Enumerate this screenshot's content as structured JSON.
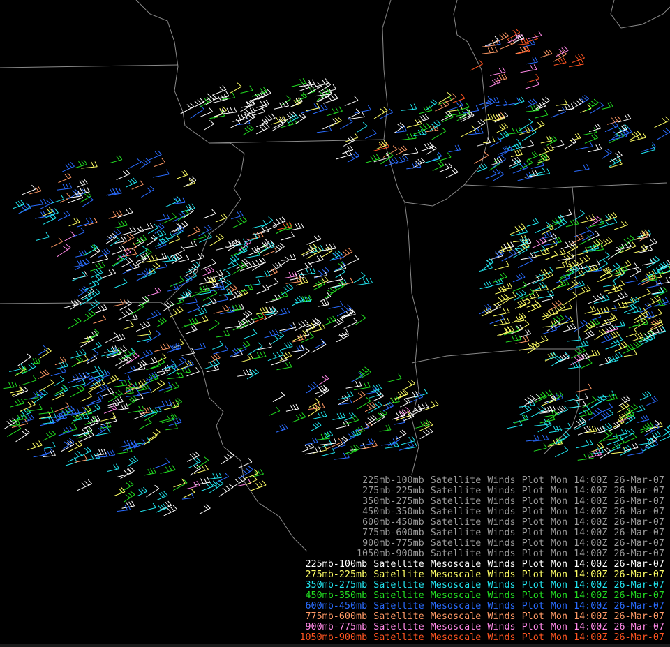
{
  "colors": {
    "background": "#000000",
    "boundaries": "#8a8a8a",
    "gray_legend": "#9a9a9a"
  },
  "layers": [
    {
      "level": "225mb-100mb",
      "color": "#ffffff",
      "short_count": 1
    },
    {
      "level": "275mb-225mb",
      "color": "#ffff66",
      "short_count": 1
    },
    {
      "level": "350mb-275mb",
      "color": "#22e6f0",
      "short_count": 1
    },
    {
      "level": "450mb-350mb",
      "color": "#22dd22",
      "short_count": 1
    },
    {
      "level": "600mb-450mb",
      "color": "#2a6cff",
      "short_count": 1
    },
    {
      "level": "775mb-600mb",
      "color": "#ff9a66",
      "short_count": 1
    },
    {
      "level": "900mb-775mb",
      "color": "#ff88e6",
      "short_count": 1
    },
    {
      "level": "1050mb-900mb",
      "color": "#ff5522",
      "short_count": 1
    }
  ],
  "legend_gray": [
    {
      "level": "225mb-100mb",
      "product": "Satellite",
      "type": "Winds",
      "kind": "Plot",
      "day": "Mon",
      "time": "14:00Z",
      "date": "26-Mar-07"
    },
    {
      "level": "275mb-225mb",
      "product": "Satellite",
      "type": "Winds",
      "kind": "Plot",
      "day": "Mon",
      "time": "14:00Z",
      "date": "26-Mar-07"
    },
    {
      "level": "350mb-275mb",
      "product": "Satellite",
      "type": "Winds",
      "kind": "Plot",
      "day": "Mon",
      "time": "14:00Z",
      "date": "26-Mar-07"
    },
    {
      "level": "450mb-350mb",
      "product": "Satellite",
      "type": "Winds",
      "kind": "Plot",
      "day": "Mon",
      "time": "14:00Z",
      "date": "26-Mar-07"
    },
    {
      "level": "600mb-450mb",
      "product": "Satellite",
      "type": "Winds",
      "kind": "Plot",
      "day": "Mon",
      "time": "14:00Z",
      "date": "26-Mar-07"
    },
    {
      "level": "775mb-600mb",
      "product": "Satellite",
      "type": "Winds",
      "kind": "Plot",
      "day": "Mon",
      "time": "14:00Z",
      "date": "26-Mar-07"
    },
    {
      "level": "900mb-775mb",
      "product": "Satellite",
      "type": "Winds",
      "kind": "Plot",
      "day": "Mon",
      "time": "14:00Z",
      "date": "26-Mar-07"
    },
    {
      "level": "1050mb-900mb",
      "product": "Satellite",
      "type": "Winds",
      "kind": "Plot",
      "day": "Mon",
      "time": "14:00Z",
      "date": "26-Mar-07"
    }
  ],
  "legend_color": [
    {
      "level": "225mb-100mb",
      "product": "Satellite",
      "scale": "Mesoscale",
      "type": "Winds",
      "kind": "Plot",
      "day": "Mon",
      "time": "14:00Z",
      "date": "26-Mar-07",
      "color": "#ffffff"
    },
    {
      "level": "275mb-225mb",
      "product": "Satellite",
      "scale": "Mesoscale",
      "type": "Winds",
      "kind": "Plot",
      "day": "Mon",
      "time": "14:00Z",
      "date": "26-Mar-07",
      "color": "#ffff66"
    },
    {
      "level": "350mb-275mb",
      "product": "Satellite",
      "scale": "Mesoscale",
      "type": "Winds",
      "kind": "Plot",
      "day": "Mon",
      "time": "14:00Z",
      "date": "26-Mar-07",
      "color": "#22e6f0"
    },
    {
      "level": "450mb-350mb",
      "product": "Satellite",
      "scale": "Mesoscale",
      "type": "Winds",
      "kind": "Plot",
      "day": "Mon",
      "time": "14:00Z",
      "date": "26-Mar-07",
      "color": "#22dd22"
    },
    {
      "level": "600mb-450mb",
      "product": "Satellite",
      "scale": "Mesoscale",
      "type": "Winds",
      "kind": "Plot",
      "day": "Mon",
      "time": "14:00Z",
      "date": "26-Mar-07",
      "color": "#2a6cff"
    },
    {
      "level": "775mb-600mb",
      "product": "Satellite",
      "scale": "Mesoscale",
      "type": "Winds",
      "kind": "Plot",
      "day": "Mon",
      "time": "14:00Z",
      "date": "26-Mar-07",
      "color": "#ff9a66"
    },
    {
      "level": "900mb-775mb",
      "product": "Satellite",
      "scale": "Mesoscale",
      "type": "Winds",
      "kind": "Plot",
      "day": "Mon",
      "time": "14:00Z",
      "date": "26-Mar-07",
      "color": "#ff88e6"
    },
    {
      "level": "1050mb-900mb",
      "product": "Satellite",
      "scale": "Mesoscale",
      "type": "Winds",
      "kind": "Plot",
      "day": "Mon",
      "time": "14:00Z",
      "date": "26-Mar-07",
      "color": "#ff5522"
    }
  ]
}
